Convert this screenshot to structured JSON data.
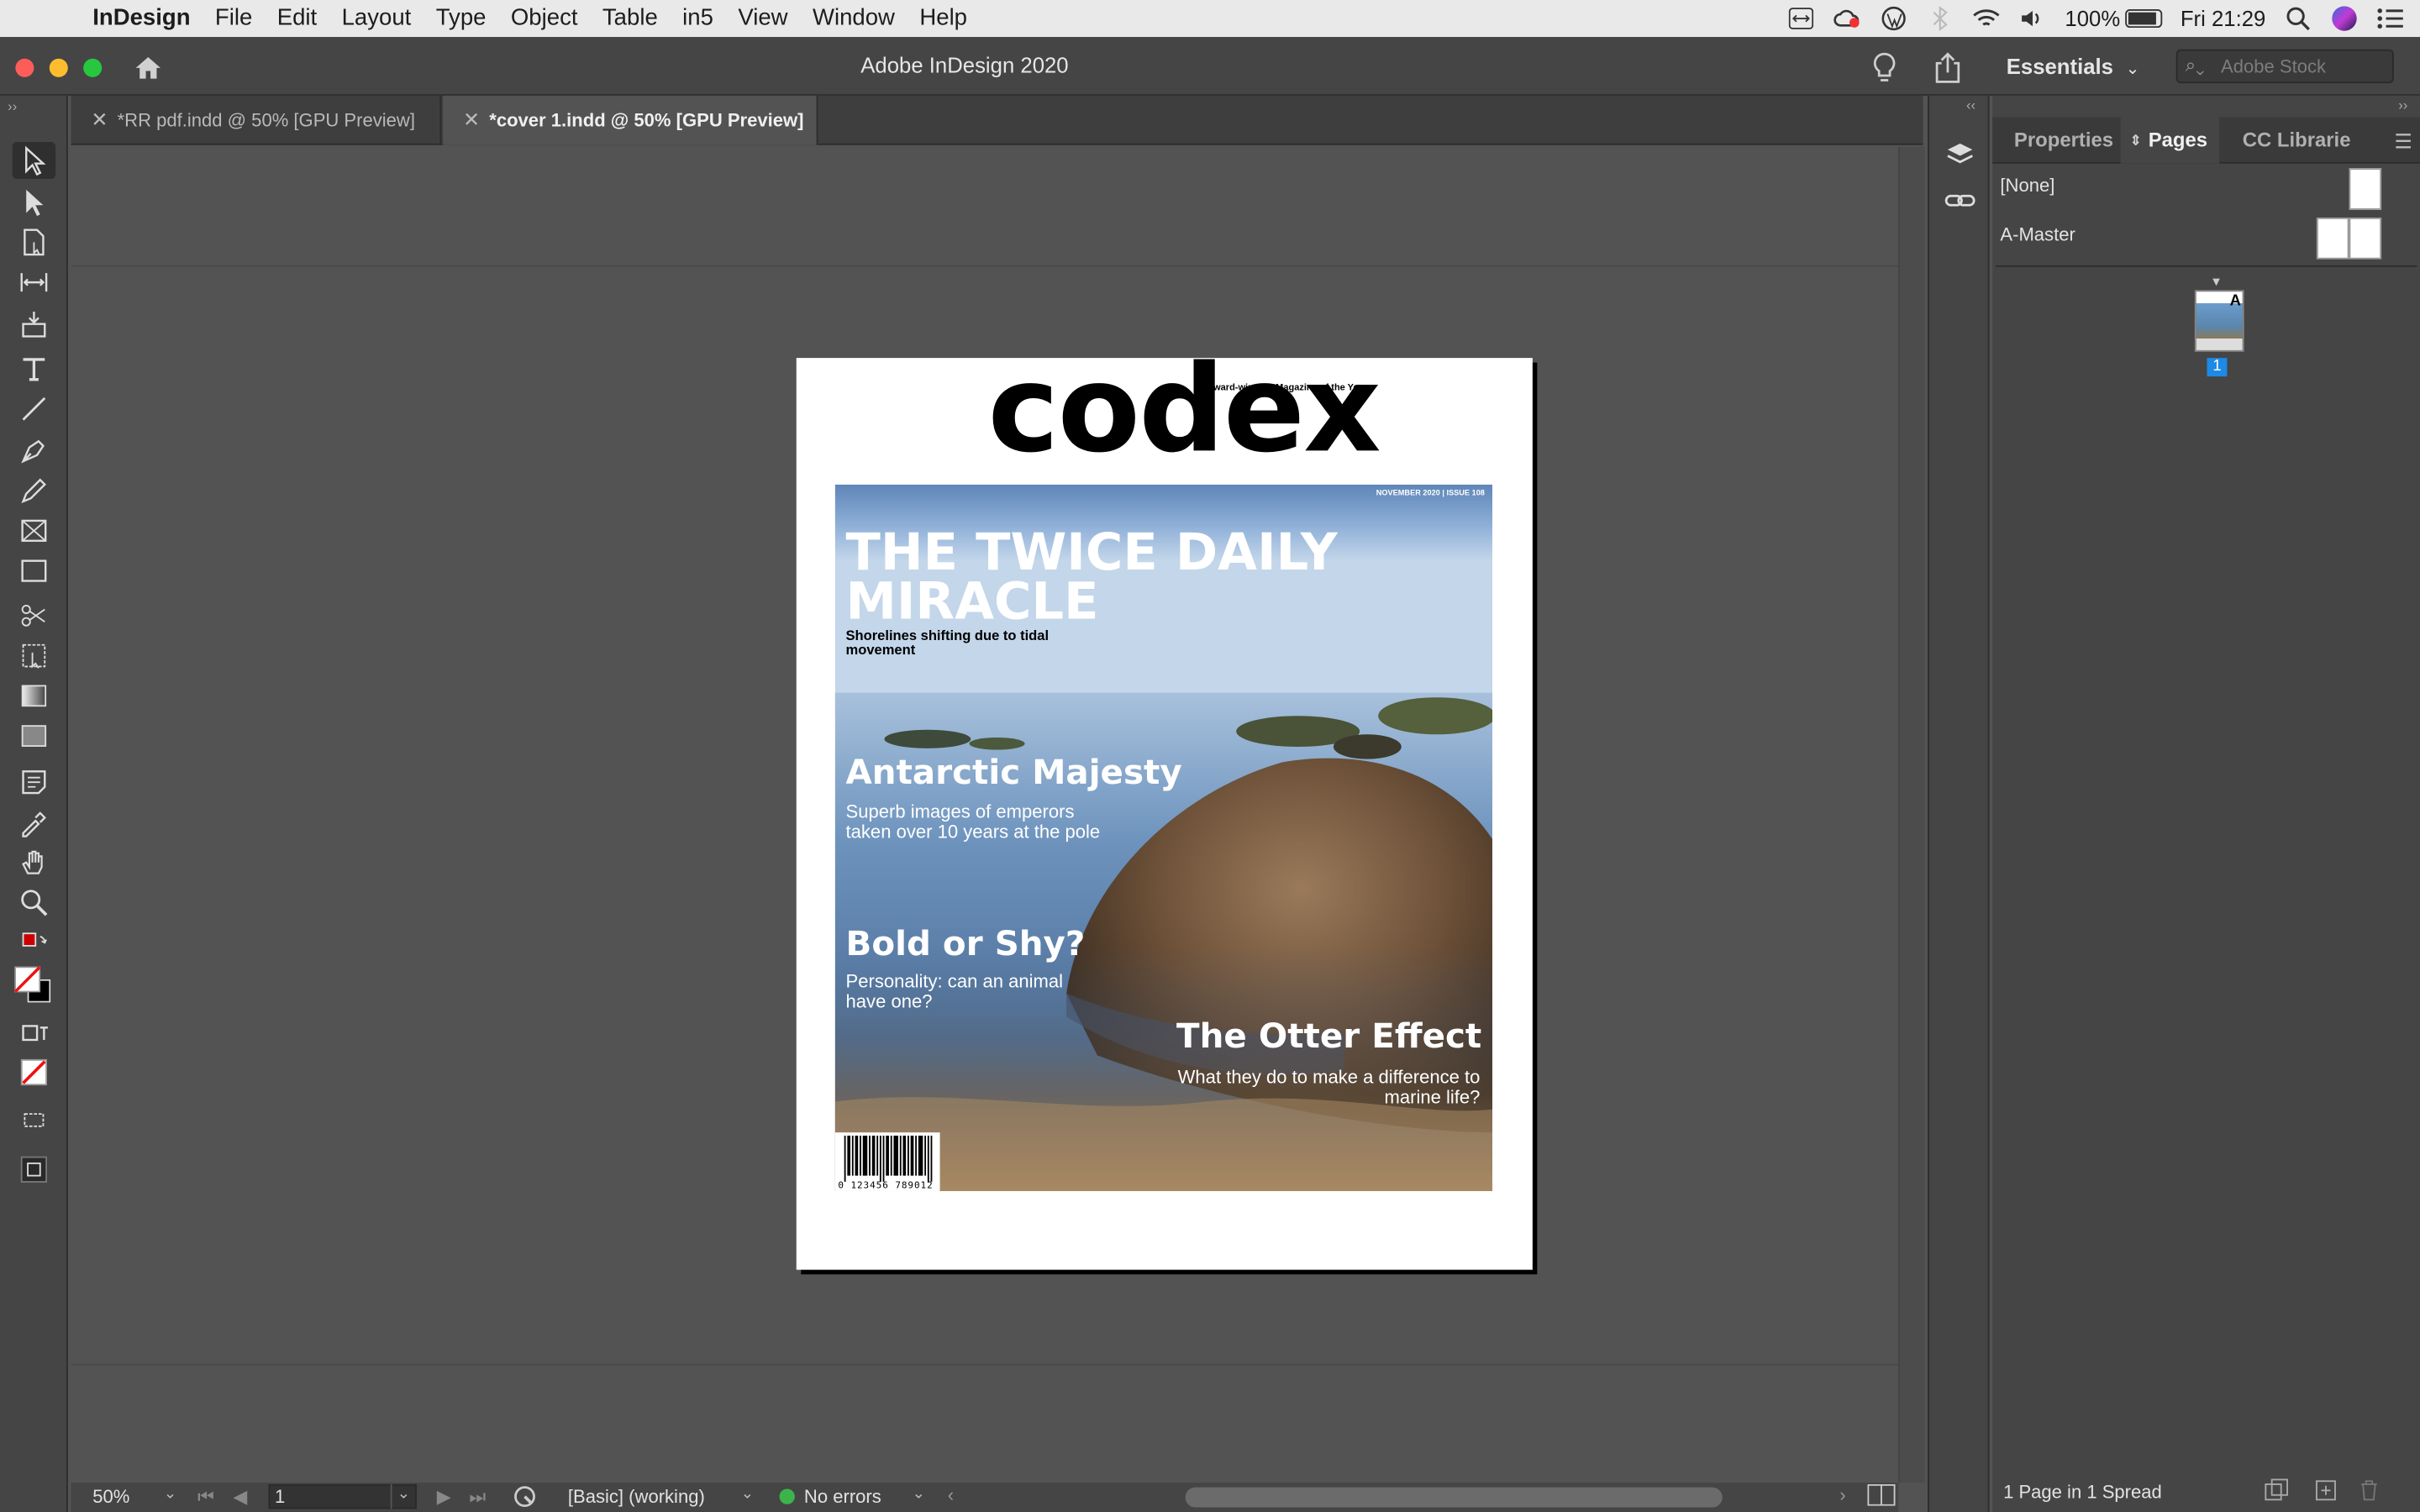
{
  "menubar": {
    "app_name": "InDesign",
    "items": [
      "File",
      "Edit",
      "Layout",
      "Type",
      "Object",
      "Table",
      "in5",
      "View",
      "Window",
      "Help"
    ],
    "battery": "100%",
    "clock": "Fri 21:29"
  },
  "titlebar": {
    "title": "Adobe InDesign 2020",
    "workspace": "Essentials",
    "stock_placeholder": "Adobe Stock"
  },
  "doc_tabs": [
    {
      "label": "*RR pdf.indd @ 50% [GPU Preview]",
      "active": false
    },
    {
      "label": "*cover 1.indd @ 50% [GPU Preview]",
      "active": true
    }
  ],
  "cover": {
    "masthead": "codex",
    "tagline": "Award-winning Magazine of the Year",
    "issue": "NOVEMBER 2020 | ISSUE 108",
    "headline1": "THE TWICE DAILY MIRACLE",
    "sub1": "Shorelines shifting due to tidal movement",
    "headline2": "Antarctic Majesty",
    "sub2": "Superb images of emperors taken over 10 years at the pole",
    "headline3": "Bold or Shy?",
    "sub3": "Personality: can an animal have one?",
    "headline4": "The Otter Effect",
    "sub4": "What they do to make a difference to marine life?",
    "barcode_number": "0 123456 789012"
  },
  "panel": {
    "tabs": [
      "Properties",
      "Pages",
      "CC Librarie"
    ],
    "active_tab": "Pages",
    "masters": [
      "[None]",
      "A-Master"
    ],
    "page_thumb_label": "A",
    "page_number": "1",
    "status": "1 Page in 1 Spread"
  },
  "statusbar": {
    "zoom": "50%",
    "page": "1",
    "preflight_profile": "[Basic] (working)",
    "errors": "No errors"
  },
  "colors": {
    "accent": "#1d8ae6",
    "ok": "#3cb44b"
  }
}
